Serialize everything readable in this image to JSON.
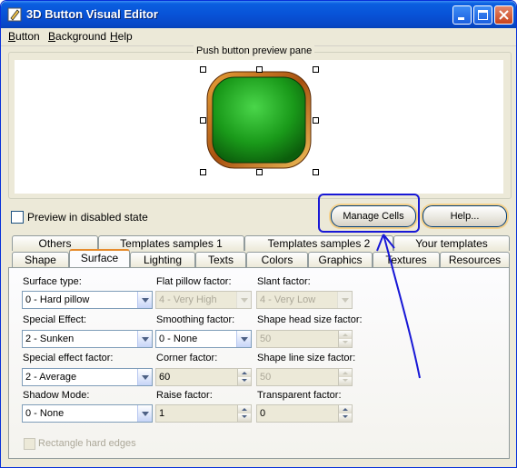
{
  "window": {
    "title": "3D Button Visual Editor"
  },
  "menu": {
    "items": [
      "Button",
      "Background",
      "Help"
    ]
  },
  "preview": {
    "caption": "Push button preview pane",
    "disabled_label": "Preview in disabled state"
  },
  "buttons": {
    "manage_cells": "Manage Cells",
    "help": "Help..."
  },
  "tabs": {
    "row_top": [
      "Others",
      "Templates samples 1",
      "Templates samples 2",
      "Your templates"
    ],
    "row_bottom": [
      "Shape",
      "Surface",
      "Lighting",
      "Texts",
      "Colors",
      "Graphics",
      "Textures",
      "Resources"
    ],
    "active": "Surface"
  },
  "fields": {
    "surface_type": {
      "label": "Surface type:",
      "value": "0 - Hard pillow"
    },
    "special_effect": {
      "label": "Special Effect:",
      "value": "2 - Sunken"
    },
    "special_effect_factor": {
      "label": "Special effect factor:",
      "value": "2 - Average"
    },
    "shadow_mode": {
      "label": "Shadow Mode:",
      "value": "0 - None"
    },
    "flat_pillow": {
      "label": "Flat pillow factor:",
      "value": "4 - Very High"
    },
    "smoothing": {
      "label": "Smoothing factor:",
      "value": "0 - None"
    },
    "corner": {
      "label": "Corner factor:",
      "value": "60"
    },
    "raise": {
      "label": "Raise factor:",
      "value": "1"
    },
    "slant": {
      "label": "Slant factor:",
      "value": "4 - Very Low"
    },
    "shape_head": {
      "label": "Shape head size factor:",
      "value": "50"
    },
    "shape_line": {
      "label": "Shape line size factor:",
      "value": "50"
    },
    "transparent": {
      "label": "Transparent factor:",
      "value": "0"
    },
    "rect_hard_edges": {
      "label": "Rectangle hard edges"
    }
  },
  "colors": {
    "titlebar": "#0853d7",
    "button_face": "#1c9a1c",
    "button_rim": "#b25a12",
    "annotation": "#1818d6"
  },
  "icons": {
    "app": "pencil-icon",
    "minimize": "minimize-icon",
    "maximize": "maximize-icon",
    "close": "close-icon"
  }
}
